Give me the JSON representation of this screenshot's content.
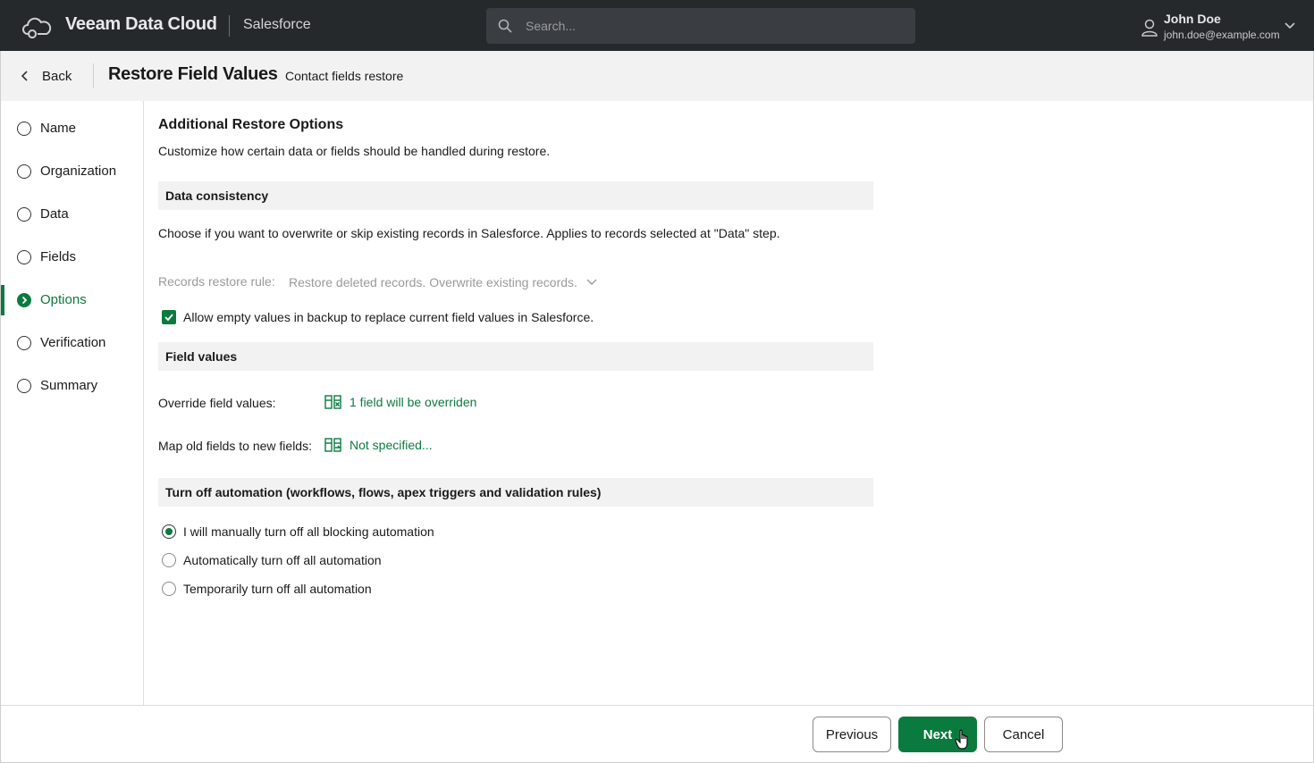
{
  "header": {
    "brand": "Veeam Data Cloud",
    "product": "Salesforce",
    "search_placeholder": "Search...",
    "user_name": "John Doe",
    "user_email": "john.doe@example.com",
    "logo_icon": "cloud-logo-icon",
    "search_icon": "search-icon",
    "user_icon": "user-icon",
    "chevron_icon": "chevron-down-icon"
  },
  "subheader": {
    "back_label": "Back",
    "title": "Restore Field Values",
    "subtitle": "Contact fields restore"
  },
  "steps": [
    {
      "label": "Name",
      "state": "pending"
    },
    {
      "label": "Organization",
      "state": "pending"
    },
    {
      "label": "Data",
      "state": "pending"
    },
    {
      "label": "Fields",
      "state": "pending"
    },
    {
      "label": "Options",
      "state": "active"
    },
    {
      "label": "Verification",
      "state": "pending"
    },
    {
      "label": "Summary",
      "state": "pending"
    }
  ],
  "main": {
    "title": "Additional Restore Options",
    "description": "Customize how certain data or fields should be handled during restore.",
    "data_consistency": {
      "header": "Data consistency",
      "description": "Choose if you want to overwrite or skip existing records in Salesforce. Applies to records selected at \"Data\" step.",
      "rule_label": "Records restore rule:",
      "rule_value": "Restore deleted records. Overwrite existing records.",
      "allow_empty_label": "Allow empty values in backup to replace current field values in Salesforce.",
      "allow_empty_checked": true
    },
    "field_values": {
      "header": "Field values",
      "override_label": "Override field values:",
      "override_value": "1 field will be overriden",
      "map_label": "Map old fields to new fields:",
      "map_value": "Not specified..."
    },
    "automation": {
      "header": "Turn off automation (workflows, flows, apex triggers and validation rules)",
      "options": [
        {
          "label": "I will manually turn off all blocking automation",
          "checked": true
        },
        {
          "label": "Automatically turn off all automation",
          "checked": false
        },
        {
          "label": "Temporarily turn off all automation",
          "checked": false
        }
      ]
    }
  },
  "footer": {
    "previous_label": "Previous",
    "next_label": "Next",
    "cancel_label": "Cancel"
  },
  "colors": {
    "accent": "#0b7a3e",
    "topbar": "#26292c"
  }
}
